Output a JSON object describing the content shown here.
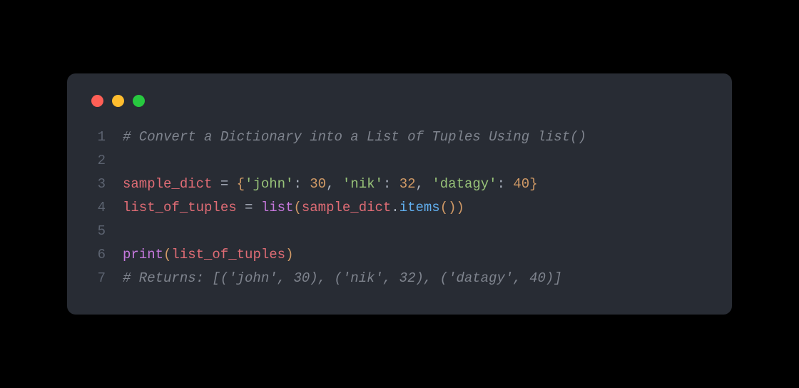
{
  "colors": {
    "background": "#000000",
    "window_bg": "#282c34",
    "traffic": {
      "red": "#ff5f56",
      "yellow": "#ffbd2e",
      "green": "#27c93f"
    },
    "syntax": {
      "comment": "#7f848e",
      "identifier": "#e06c75",
      "operator": "#abb2bf",
      "punct": "#abb2bf",
      "brace": "#d19a66",
      "string": "#98c379",
      "number": "#d19a66",
      "builtin": "#c678dd",
      "method": "#61afef",
      "line_number": "#5c6370"
    }
  },
  "code": {
    "language": "python",
    "lines": [
      {
        "num": "1",
        "tokens": [
          {
            "t": "# Convert a Dictionary into a List of Tuples Using list()",
            "c": "comment"
          }
        ]
      },
      {
        "num": "2",
        "tokens": []
      },
      {
        "num": "3",
        "tokens": [
          {
            "t": "sample_dict",
            "c": "identifier"
          },
          {
            "t": " ",
            "c": "default"
          },
          {
            "t": "=",
            "c": "operator"
          },
          {
            "t": " ",
            "c": "default"
          },
          {
            "t": "{",
            "c": "brace"
          },
          {
            "t": "'john'",
            "c": "string"
          },
          {
            "t": ": ",
            "c": "punct"
          },
          {
            "t": "30",
            "c": "number"
          },
          {
            "t": ", ",
            "c": "punct"
          },
          {
            "t": "'nik'",
            "c": "string"
          },
          {
            "t": ": ",
            "c": "punct"
          },
          {
            "t": "32",
            "c": "number"
          },
          {
            "t": ", ",
            "c": "punct"
          },
          {
            "t": "'datagy'",
            "c": "string"
          },
          {
            "t": ": ",
            "c": "punct"
          },
          {
            "t": "40",
            "c": "number"
          },
          {
            "t": "}",
            "c": "brace"
          }
        ]
      },
      {
        "num": "4",
        "tokens": [
          {
            "t": "list_of_tuples",
            "c": "identifier"
          },
          {
            "t": " ",
            "c": "default"
          },
          {
            "t": "=",
            "c": "operator"
          },
          {
            "t": " ",
            "c": "default"
          },
          {
            "t": "list",
            "c": "builtin"
          },
          {
            "t": "(",
            "c": "brace"
          },
          {
            "t": "sample_dict",
            "c": "identifier"
          },
          {
            "t": ".",
            "c": "punct"
          },
          {
            "t": "items",
            "c": "method"
          },
          {
            "t": "(",
            "c": "brace"
          },
          {
            "t": ")",
            "c": "brace"
          },
          {
            "t": ")",
            "c": "brace"
          }
        ]
      },
      {
        "num": "5",
        "tokens": []
      },
      {
        "num": "6",
        "tokens": [
          {
            "t": "print",
            "c": "builtin"
          },
          {
            "t": "(",
            "c": "brace"
          },
          {
            "t": "list_of_tuples",
            "c": "identifier"
          },
          {
            "t": ")",
            "c": "brace"
          }
        ]
      },
      {
        "num": "7",
        "tokens": [
          {
            "t": "# Returns: [('john', 30), ('nik', 32), ('datagy', 40)]",
            "c": "comment"
          }
        ]
      }
    ]
  }
}
